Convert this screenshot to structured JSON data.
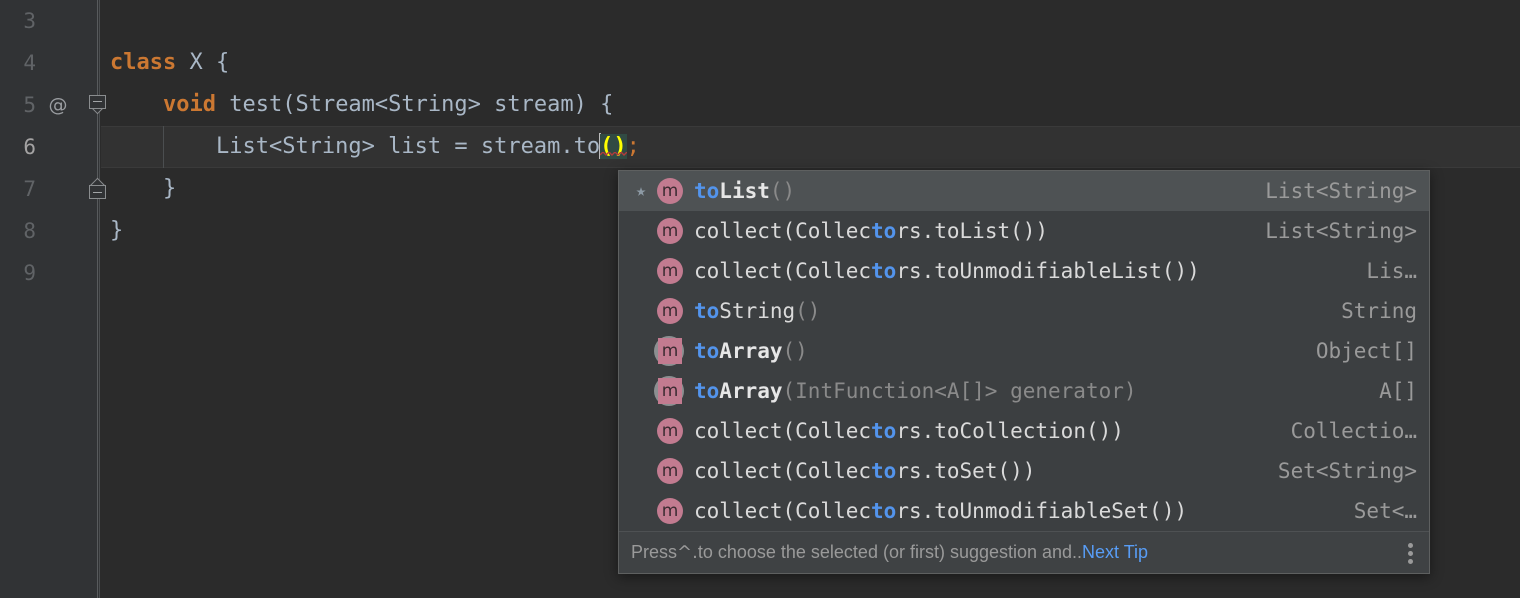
{
  "editor": {
    "lines": [
      {
        "num": "3",
        "annotation": "",
        "fold": "",
        "current": false,
        "indent_guide": false,
        "tokens": []
      },
      {
        "num": "4",
        "annotation": "",
        "fold": "",
        "current": false,
        "indent_guide": false,
        "tokens": [
          {
            "t": "kw",
            "s": "class"
          },
          {
            "t": "plain",
            "s": " "
          },
          {
            "t": "ident",
            "s": "X"
          },
          {
            "t": "plain",
            "s": " "
          },
          {
            "t": "punc",
            "s": "{"
          }
        ]
      },
      {
        "num": "5",
        "annotation": "@",
        "fold": "down",
        "current": false,
        "indent_guide": false,
        "tokens": [
          {
            "t": "plain",
            "s": "    "
          },
          {
            "t": "kw",
            "s": "void"
          },
          {
            "t": "plain",
            "s": " "
          },
          {
            "t": "ident",
            "s": "test"
          },
          {
            "t": "punc",
            "s": "("
          },
          {
            "t": "typ",
            "s": "Stream<String>"
          },
          {
            "t": "plain",
            "s": " "
          },
          {
            "t": "ident",
            "s": "stream"
          },
          {
            "t": "punc",
            "s": ") {"
          }
        ]
      },
      {
        "num": "6",
        "annotation": "",
        "fold": "",
        "current": true,
        "indent_guide": true,
        "tokens": [
          {
            "t": "plain",
            "s": "        "
          },
          {
            "t": "typ",
            "s": "List<String>"
          },
          {
            "t": "plain",
            "s": " "
          },
          {
            "t": "ident",
            "s": "list"
          },
          {
            "t": "plain",
            "s": " "
          },
          {
            "t": "op",
            "s": "="
          },
          {
            "t": "plain",
            "s": " "
          },
          {
            "t": "ident",
            "s": "stream"
          },
          {
            "t": "punc",
            "s": "."
          },
          {
            "t": "ident",
            "s": "to"
          },
          {
            "t": "caret",
            "s": ""
          },
          {
            "t": "template",
            "s": "()"
          },
          {
            "t": "semi",
            "s": ";"
          }
        ]
      },
      {
        "num": "7",
        "annotation": "",
        "fold": "up",
        "current": false,
        "indent_guide": false,
        "tokens": [
          {
            "t": "plain",
            "s": "    "
          },
          {
            "t": "punc",
            "s": "}"
          }
        ]
      },
      {
        "num": "8",
        "annotation": "",
        "fold": "",
        "current": false,
        "indent_guide": false,
        "tokens": [
          {
            "t": "punc",
            "s": "}"
          }
        ]
      },
      {
        "num": "9",
        "annotation": "",
        "fold": "",
        "current": false,
        "indent_guide": false,
        "tokens": []
      }
    ]
  },
  "completion_popup": {
    "star_glyph": "★",
    "method_icon_letter": "m",
    "items": [
      {
        "selected": true,
        "starred": true,
        "icon": "method-icon",
        "segments": [
          {
            "style": "hit",
            "text": "to"
          },
          {
            "style": "bold",
            "text": "List"
          },
          {
            "style": "dim",
            "text": "()"
          }
        ],
        "plain_label": "toList()",
        "return_type": "List<String>"
      },
      {
        "selected": false,
        "starred": false,
        "icon": "method-icon",
        "segments": [
          {
            "style": "name",
            "text": "collect(Collec"
          },
          {
            "style": "hit",
            "text": "to"
          },
          {
            "style": "name",
            "text": "rs.toList())"
          }
        ],
        "plain_label": "collect(Collectors.toList())",
        "return_type": "List<String>"
      },
      {
        "selected": false,
        "starred": false,
        "icon": "method-icon",
        "segments": [
          {
            "style": "name",
            "text": "collect(Collec"
          },
          {
            "style": "hit",
            "text": "to"
          },
          {
            "style": "name",
            "text": "rs.toUnmodifiableList())"
          }
        ],
        "plain_label": "collect(Collectors.toUnmodifiableList())",
        "return_type": "Lis…"
      },
      {
        "selected": false,
        "starred": false,
        "icon": "method-icon",
        "segments": [
          {
            "style": "hit",
            "text": "to"
          },
          {
            "style": "name",
            "text": "String"
          },
          {
            "style": "dim",
            "text": "()"
          }
        ],
        "plain_label": "toString()",
        "return_type": "String"
      },
      {
        "selected": false,
        "starred": false,
        "icon": "abstract-method-icon",
        "segments": [
          {
            "style": "hit",
            "text": "to"
          },
          {
            "style": "bold",
            "text": "Array"
          },
          {
            "style": "dim",
            "text": "()"
          }
        ],
        "plain_label": "toArray()",
        "return_type": "Object[]"
      },
      {
        "selected": false,
        "starred": false,
        "icon": "abstract-method-icon",
        "segments": [
          {
            "style": "hit",
            "text": "to"
          },
          {
            "style": "bold",
            "text": "Array"
          },
          {
            "style": "dim",
            "text": "(IntFunction<A[]> generator)"
          }
        ],
        "plain_label": "toArray(IntFunction<A[]> generator)",
        "return_type": "A[]"
      },
      {
        "selected": false,
        "starred": false,
        "icon": "method-icon",
        "segments": [
          {
            "style": "name",
            "text": "collect(Collec"
          },
          {
            "style": "hit",
            "text": "to"
          },
          {
            "style": "name",
            "text": "rs.toCollection())"
          }
        ],
        "plain_label": "collect(Collectors.toCollection())",
        "return_type": "Collectio…"
      },
      {
        "selected": false,
        "starred": false,
        "icon": "method-icon",
        "segments": [
          {
            "style": "name",
            "text": "collect(Collec"
          },
          {
            "style": "hit",
            "text": "to"
          },
          {
            "style": "name",
            "text": "rs.toSet())"
          }
        ],
        "plain_label": "collect(Collectors.toSet())",
        "return_type": "Set<String>"
      },
      {
        "selected": false,
        "starred": false,
        "icon": "method-icon",
        "segments": [
          {
            "style": "name",
            "text": "collect(Collec"
          },
          {
            "style": "hit",
            "text": "to"
          },
          {
            "style": "name",
            "text": "rs.toUnmodifiableSet())"
          }
        ],
        "plain_label": "collect(Collectors.toUnmodifiableSet())",
        "return_type": "Set<…"
      }
    ],
    "hint": {
      "text_before": "Press ",
      "shortcut": "^.",
      "text_after": " to choose the selected (or first) suggestion and..",
      "link_label": "Next Tip"
    }
  },
  "colors": {
    "editor_background": "#2b2b2b",
    "gutter_background": "#313335",
    "current_line_background": "#323232",
    "popup_background": "#3c3f41",
    "popup_selected_row": "#4e5254",
    "popup_hint_background": "#3f4244",
    "keyword": "#cc7832",
    "identifier": "#a9b7c6",
    "match_highlight": "#5394ec",
    "link": "#589df6",
    "template_text": "#ffff00",
    "template_background": "#314a43",
    "method_icon": "#c27b90"
  }
}
